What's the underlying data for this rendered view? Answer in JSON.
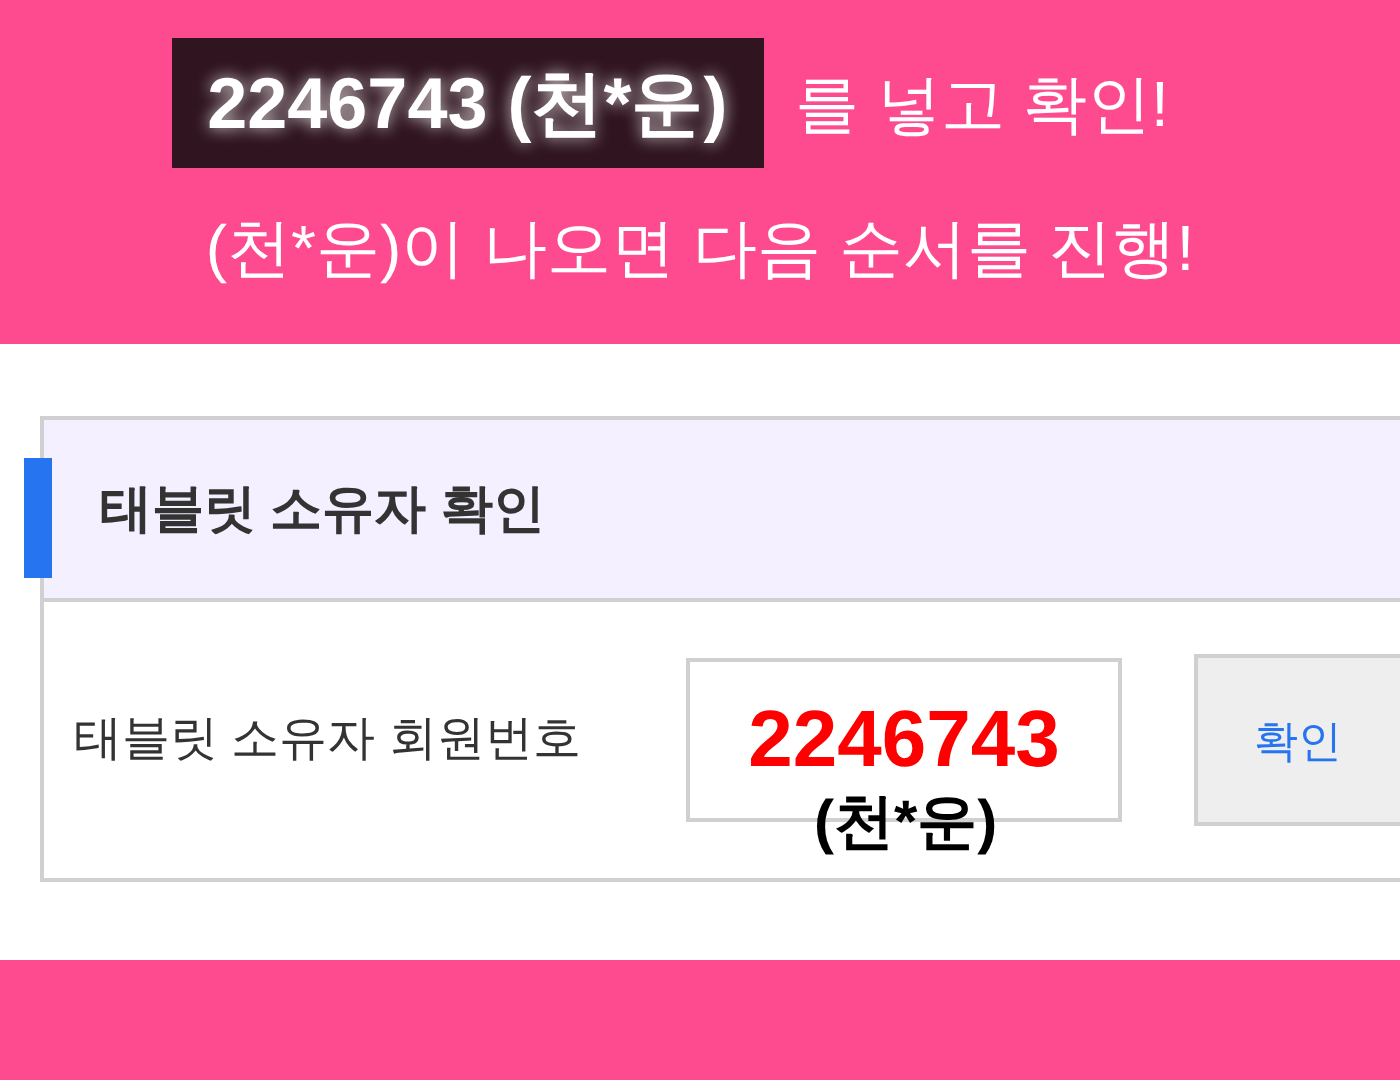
{
  "banner": {
    "highlight": "2246743 (천*운)",
    "line_1_rest": "를 넣고 확인!",
    "line_2": "(천*운)이 나오면 다음 순서를 진행!"
  },
  "form": {
    "title": "태블릿 소유자 확인",
    "field_label": "태블릿 소유자 회원번호",
    "field_value": "2246743",
    "annotation": "(천*운)",
    "button": "확인"
  }
}
